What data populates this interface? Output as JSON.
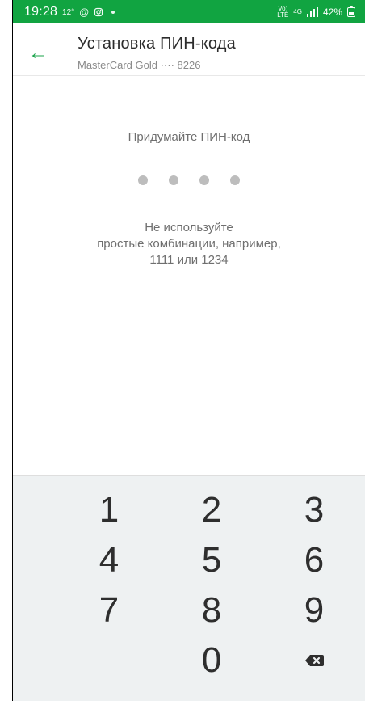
{
  "status_bar": {
    "time": "19:28",
    "temp": "12°",
    "icons": [
      "at-icon",
      "instagram-icon",
      "notification-dot"
    ],
    "right_mini_1": "Vo)\nLTE",
    "right_mini_2": "4G",
    "battery_percent_label": "42%",
    "battery_fraction": 0.42,
    "colors": {
      "background": "#11a441",
      "text": "#ffffff"
    }
  },
  "app_bar": {
    "back_icon": "arrow-left-icon",
    "title": "Установка ПИН-кода",
    "subtitle": "MasterCard Gold ···· 8226",
    "colors": {
      "accent": "#1aa34a",
      "title": "#2c2c2c",
      "subtitle": "#8a8a8a"
    }
  },
  "pin_entry": {
    "prompt": "Придумайте ПИН-код",
    "dots_count": 4,
    "hint_lines": [
      "Не используйте",
      "простые комбинации, например,",
      "1111 или 1234"
    ],
    "colors": {
      "text": "#6f6f6f",
      "dot": "#bdbdbd"
    }
  },
  "keypad": {
    "keys": [
      "1",
      "2",
      "3",
      "4",
      "5",
      "6",
      "7",
      "8",
      "9",
      "",
      "0",
      "backspace"
    ],
    "icons": {
      "backspace": "backspace-icon"
    },
    "colors": {
      "background": "#eef1f2",
      "text": "#2e2e2e"
    }
  }
}
